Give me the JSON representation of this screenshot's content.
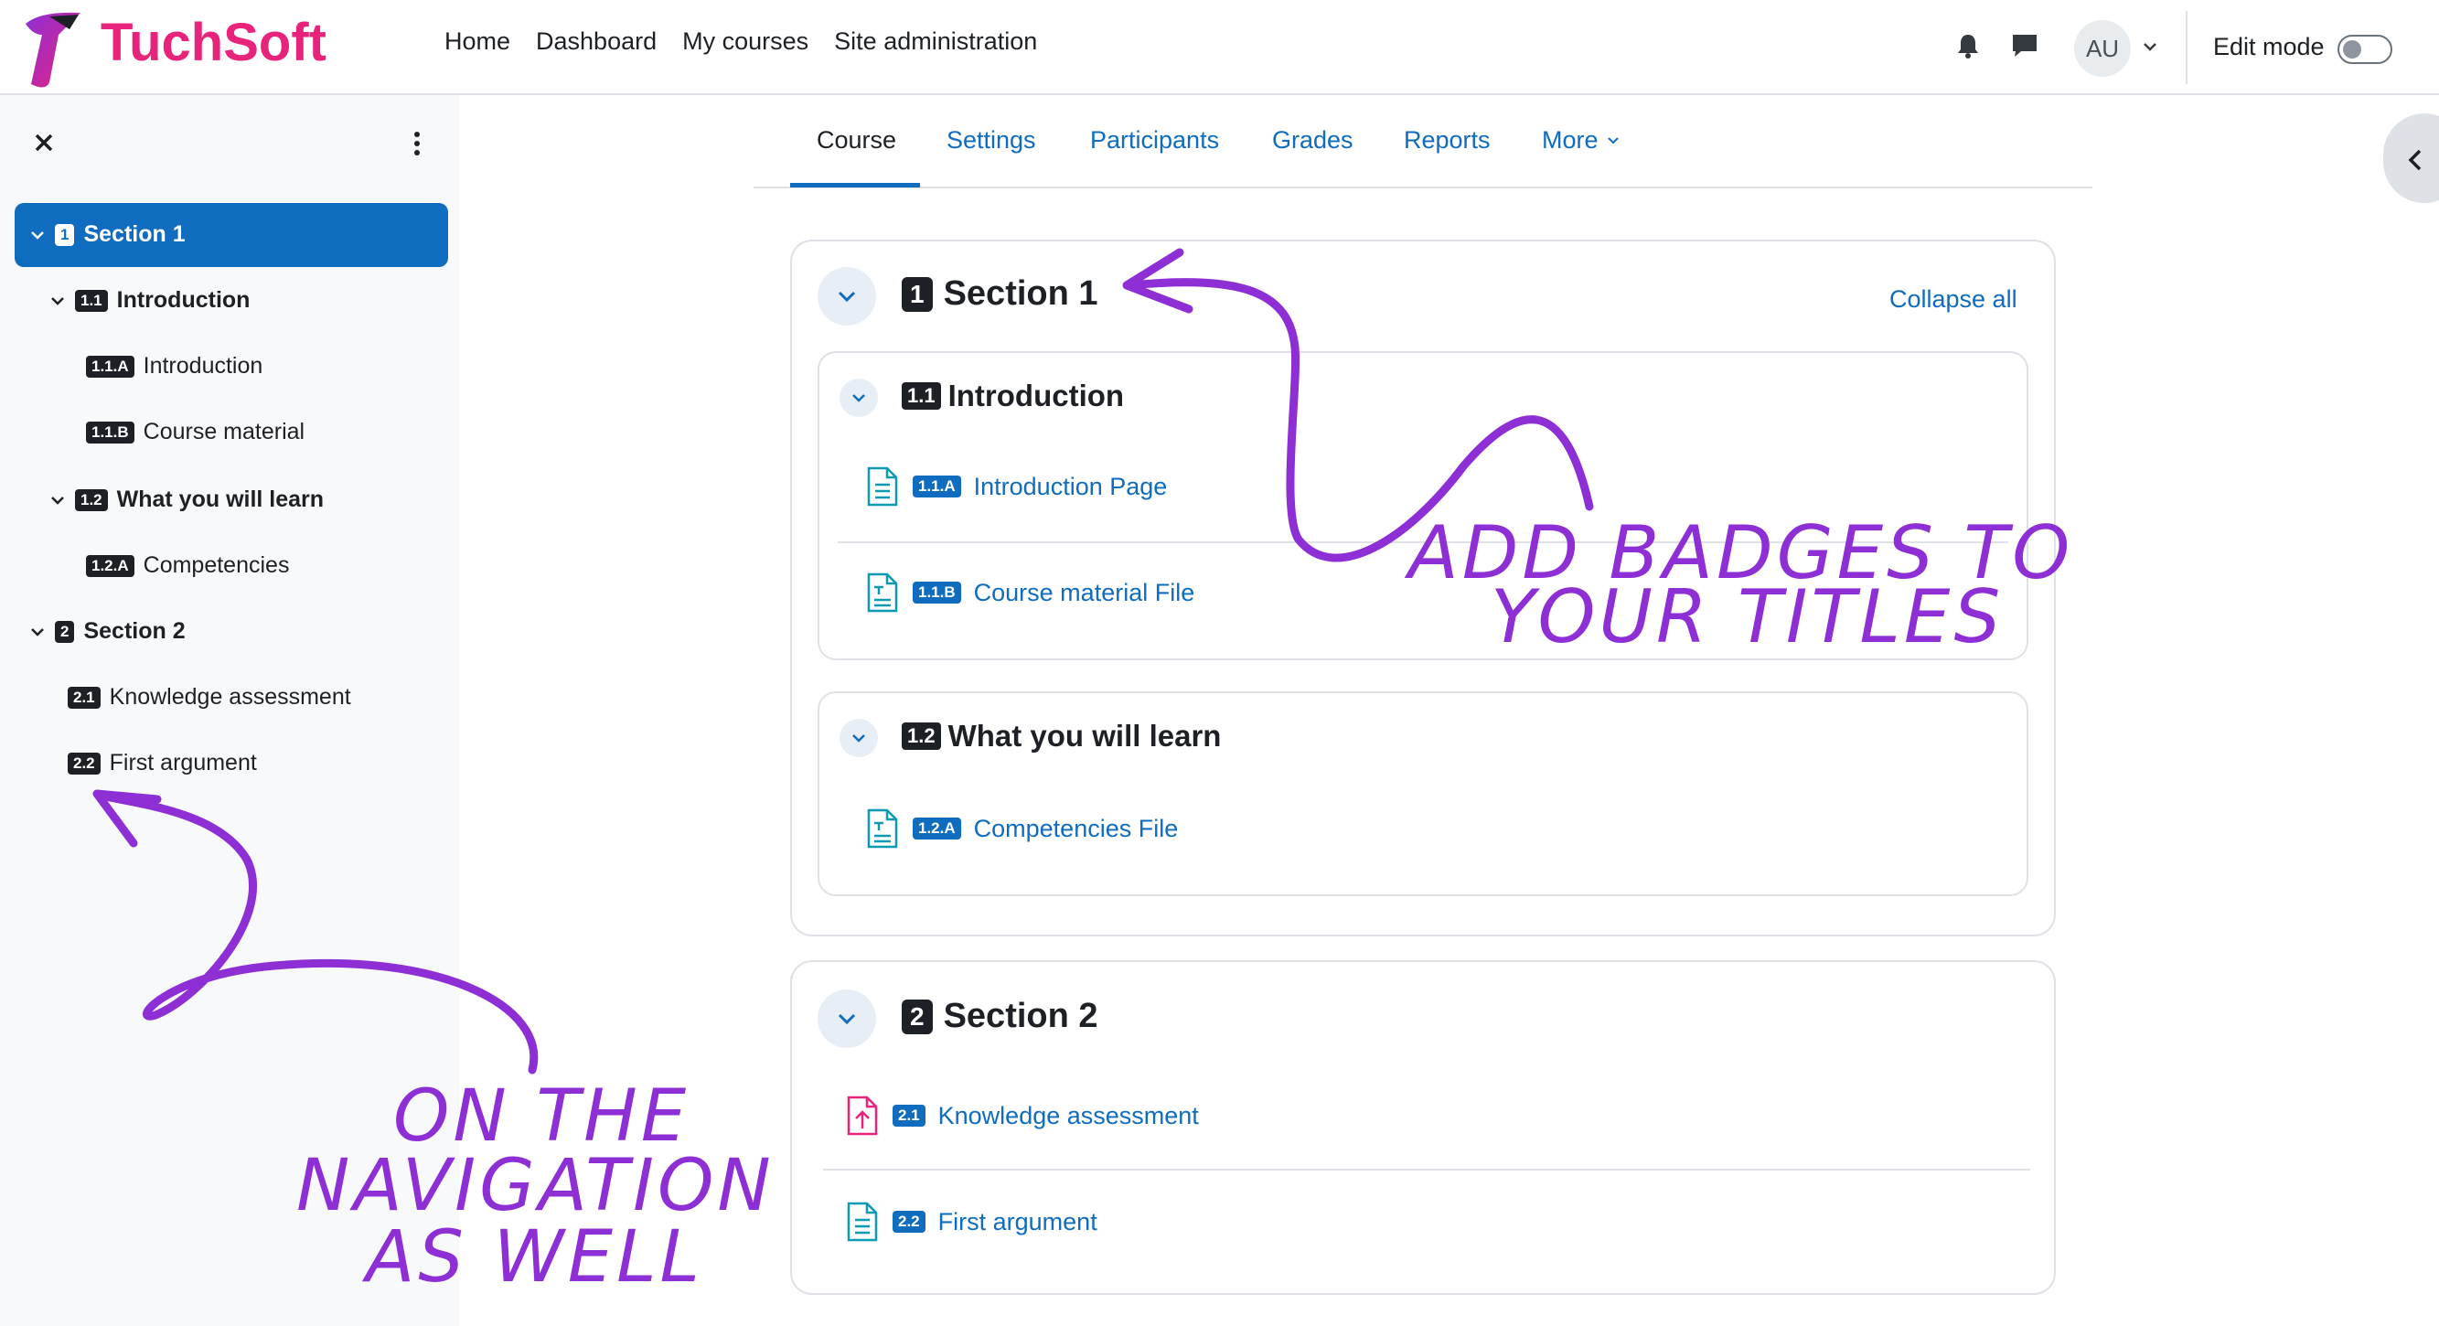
{
  "brand": {
    "name": "TuchSoft"
  },
  "navbar": {
    "links": [
      "Home",
      "Dashboard",
      "My courses",
      "Site administration"
    ],
    "user_initials": "AU",
    "edit_mode_label": "Edit mode",
    "icons": [
      "bell-icon",
      "chat-icon",
      "chevron-down-icon"
    ]
  },
  "tabs": [
    {
      "label": "Course"
    },
    {
      "label": "Settings"
    },
    {
      "label": "Participants"
    },
    {
      "label": "Grades"
    },
    {
      "label": "Reports"
    },
    {
      "label": "More"
    }
  ],
  "course_index": {
    "items": [
      {
        "badge": "1",
        "label": "Section 1",
        "level": 0,
        "active": true
      },
      {
        "badge": "1.1",
        "label": "Introduction",
        "level": 1
      },
      {
        "badge": "1.1.A",
        "label": "Introduction",
        "level": 2
      },
      {
        "badge": "1.1.B",
        "label": "Course material",
        "level": 2
      },
      {
        "badge": "1.2",
        "label": "What you will learn",
        "level": 1
      },
      {
        "badge": "1.2.A",
        "label": "Competencies",
        "level": 2
      },
      {
        "badge": "2",
        "label": "Section 2",
        "level": 0
      },
      {
        "badge": "2.1",
        "label": "Knowledge assessment",
        "level": 1
      },
      {
        "badge": "2.2",
        "label": "First argument",
        "level": 1
      }
    ]
  },
  "content": {
    "collapse_all": "Collapse all",
    "sections": [
      {
        "badge": "1",
        "title": "Section 1",
        "subsections": [
          {
            "badge": "1.1",
            "title": "Introduction",
            "activities": [
              {
                "badge": "1.1.A",
                "label": "Introduction Page",
                "icon": "page-icon"
              },
              {
                "badge": "1.1.B",
                "label": "Course material File",
                "icon": "file-icon"
              }
            ]
          },
          {
            "badge": "1.2",
            "title": "What you will learn",
            "activities": [
              {
                "badge": "1.2.A",
                "label": "Competencies File",
                "icon": "file-icon"
              }
            ]
          }
        ]
      },
      {
        "badge": "2",
        "title": "Section 2",
        "activities": [
          {
            "badge": "2.1",
            "label": "Knowledge assessment",
            "icon": "assignment-icon"
          },
          {
            "badge": "2.2",
            "label": "First argument",
            "icon": "page-icon"
          }
        ]
      }
    ]
  },
  "annotations": {
    "top_right": [
      "ADD BADGES TO",
      "YOUR TITLES"
    ],
    "bottom_left": [
      "ON THE",
      "NAVIGATION",
      "AS WELL"
    ]
  },
  "colors": {
    "accent": "#0f6cbf",
    "annotation": "#8e2fd6",
    "badge_dark": "#1d2125",
    "assignment_icon": "#e8237c",
    "page_icon": "#0e9ab3"
  }
}
